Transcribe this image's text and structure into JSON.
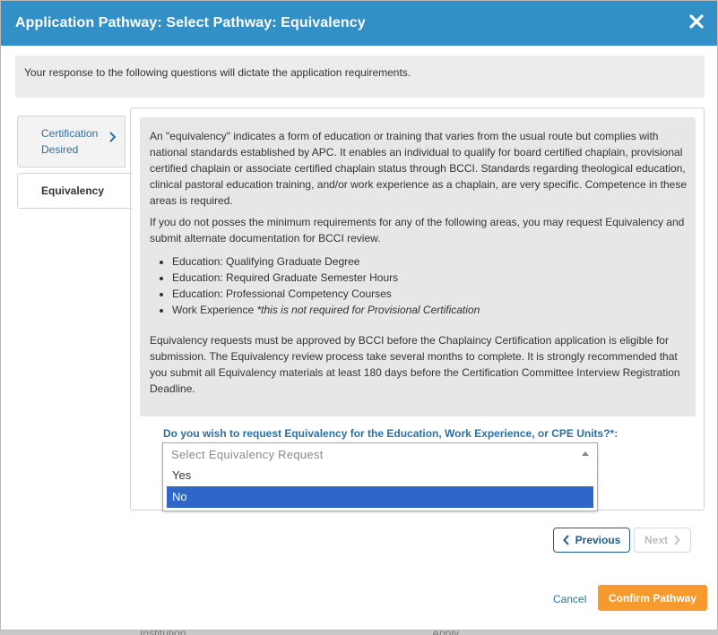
{
  "backdrop": {
    "left_text": "Institution",
    "right_text": "Apply"
  },
  "modal": {
    "title": "Application Pathway: Select Pathway: Equivalency",
    "close_icon": "close-icon",
    "intro": "Your response to the following questions will dictate the application requirements."
  },
  "steps": [
    {
      "label": "Certification Desired",
      "icon": "chevron-right-icon"
    },
    {
      "label": "Equivalency"
    }
  ],
  "info": {
    "para1": "An \"equivalency\" indicates a form of education or training that varies from the usual route but complies with national standards established by APC. It enables an individual to qualify for board certified chaplain, provisional certified chaplain or associate certified chaplain status through BCCI. Standards regarding theological education, clinical pastoral education training, and/or work experience as a chaplain, are very specific. Competence in these areas is required.",
    "para2": "If you do not posses the minimum requirements for any of the following areas, you may request Equivalency and submit alternate documentation for BCCI review.",
    "bullets": [
      "Education: Qualifying Graduate Degree",
      "Education: Required Graduate Semester Hours",
      "Education: Professional Competency Courses",
      "Work Experience"
    ],
    "bullet4_note": "*this is not required for Provisional Certification",
    "para3": "Equivalency requests must be approved by BCCI before the Chaplaincy Certification application is eligible for submission. The Equivalency review process take several months to complete. It is strongly recommended that you submit all Equivalency materials at least 180 days before the Certification Committee Interview Registration Deadline."
  },
  "question": {
    "label": "Do you wish to request Equivalency for the Education, Work Experience, or CPE Units?*:",
    "placeholder": "Select Equivalency Request",
    "options": [
      "Yes",
      "No"
    ],
    "highlighted": "No"
  },
  "buttons": {
    "previous": "Previous",
    "next": "Next",
    "cancel": "Cancel",
    "confirm": "Confirm Pathway"
  },
  "colors": {
    "header": "#3390c7",
    "accent_link": "#2d6fa3",
    "confirm": "#f79a2e",
    "option_highlight": "#2e67c8"
  }
}
